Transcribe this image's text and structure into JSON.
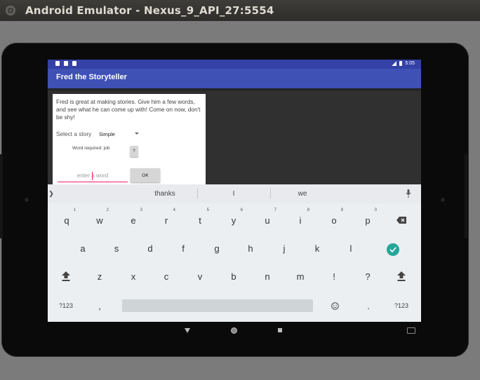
{
  "window": {
    "title": "Android Emulator - Nexus_9_API_27:5554"
  },
  "status_bar": {
    "time": "5:05"
  },
  "app": {
    "title": "Fred the Storyteller",
    "intro": "Fred is great at making stories. Give him a few words, and see what he can come up with! Come on now, don't be shy!",
    "select_label": "Select a story",
    "select_value": "Simple",
    "word_required": "Word required: job",
    "help_button": "?",
    "input_placeholder": "enter a word",
    "ok_button": "OK",
    "accent_color": "#3f51b5",
    "status_color": "#3441a6",
    "input_underline_color": "#e91e63"
  },
  "keyboard": {
    "suggestions": [
      "thanks",
      "I",
      "we"
    ],
    "row1": [
      {
        "key": "q",
        "hint": "1"
      },
      {
        "key": "w",
        "hint": "2"
      },
      {
        "key": "e",
        "hint": "3"
      },
      {
        "key": "r",
        "hint": "4"
      },
      {
        "key": "t",
        "hint": "5"
      },
      {
        "key": "y",
        "hint": "6"
      },
      {
        "key": "u",
        "hint": "7"
      },
      {
        "key": "i",
        "hint": "8"
      },
      {
        "key": "o",
        "hint": "9"
      },
      {
        "key": "p",
        "hint": "0"
      }
    ],
    "row2": [
      "a",
      "s",
      "d",
      "f",
      "g",
      "h",
      "j",
      "k",
      "l"
    ],
    "row3": [
      "z",
      "x",
      "c",
      "v",
      "b",
      "n",
      "m",
      "!",
      "?"
    ],
    "symbols_label": "?123",
    "comma": ",",
    "period": ".",
    "enter_color": "#26a69a"
  }
}
